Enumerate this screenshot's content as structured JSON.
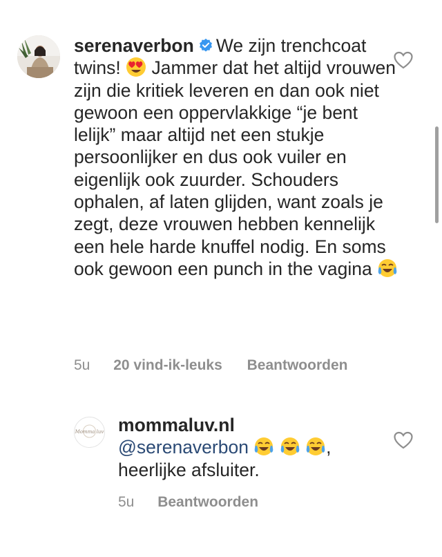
{
  "comment": {
    "username": "serenaverbon",
    "verified": true,
    "text_1": "We zijn trenchcoat twins! ",
    "emoji_1": "heart-eyes-emoji",
    "text_2": " Jammer dat het altijd vrouwen zijn die kritiek leveren en dan ook niet gewoon een oppervlakkige “je bent lelijk” maar altijd net een stukje persoonlijker en dus ook vuiler en eigenlijk ook zuurder. Schouders ophalen, af laten glijden, want zoals je zegt, deze vrouwen hebben kennelijk een hele harde knuffel nodig. En soms ook gewoon een punch in the vagina ",
    "emoji_2": "tears-of-joy-emoji",
    "time": "5u",
    "likes": "20 vind-ik-leuks",
    "reply_label": "Beantwoorden"
  },
  "reply": {
    "username": "mommaluv.nl",
    "mention": "@serenaverbon",
    "emojis": [
      "tears-of-joy-emoji",
      "tears-of-joy-emoji",
      "tears-of-joy-emoji"
    ],
    "text": ", heerlijke afsluiter.",
    "avatar_logo_text": "Momma luv",
    "time": "5u",
    "reply_label": "Beantwoorden"
  },
  "colors": {
    "text": "#262626",
    "meta": "#8e8e8e",
    "mention": "#2b4a75",
    "verified": "#3897f0"
  }
}
